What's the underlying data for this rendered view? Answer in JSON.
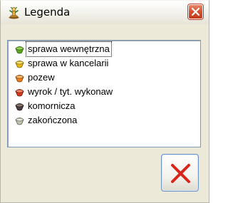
{
  "window": {
    "title": "Legenda",
    "title_icon": "statue-icon",
    "close_icon": "close-icon"
  },
  "legend": {
    "items": [
      {
        "label": "sprawa wewnętrzna",
        "icon": "green-cup-bullet",
        "color": "#5aa61e",
        "selected": true
      },
      {
        "label": "sprawa w kancelarii",
        "icon": "yellow-cup-bullet",
        "color": "#e8b914",
        "selected": false
      },
      {
        "label": "pozew",
        "icon": "orange-cup-bullet",
        "color": "#ef7d1a",
        "selected": false
      },
      {
        "label": "wyrok / tyt. wykonaw",
        "icon": "red-cup-bullet",
        "color": "#d23b1e",
        "selected": false
      },
      {
        "label": "komornicza",
        "icon": "dark-cup-bullet",
        "color": "#4d4040",
        "selected": false
      },
      {
        "label": "zakończona",
        "icon": "gray-cup-bullet",
        "color": "#bfc5b0",
        "selected": false
      }
    ]
  },
  "actions": {
    "cancel_icon": "red-x-icon",
    "cancel_color": "#d8261c"
  }
}
